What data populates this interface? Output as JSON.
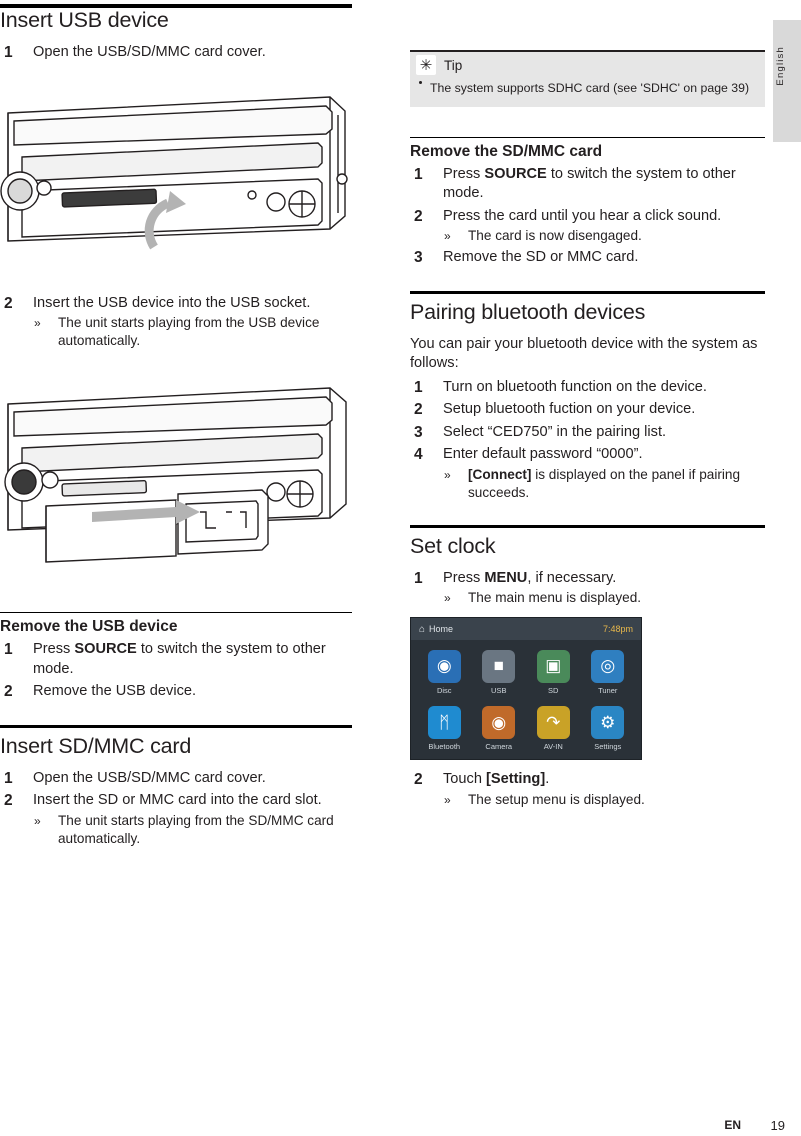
{
  "side_tab": {
    "label": "English"
  },
  "footer": {
    "lang": "EN",
    "page": "19"
  },
  "left": {
    "h_insert_usb": "Insert USB device",
    "step1": "Open the USB/SD/MMC card cover.",
    "step2": "Insert the USB device into the USB socket.",
    "step2_note": "The unit starts playing from the USB device automatically.",
    "h_remove_usb": "Remove the USB device",
    "r1_a": "Press ",
    "r1_b": "SOURCE",
    "r1_c": " to switch the system to other mode.",
    "r2": "Remove the USB device.",
    "h_insert_sd": "Insert SD/MMC card",
    "s1": "Open the USB/SD/MMC card cover.",
    "s2": "Insert the SD or MMC card into the card slot.",
    "s2_note": "The unit starts playing from the SD/MMC card automatically.",
    "numbers": {
      "n1": "1",
      "n2": "2",
      "n3": "3",
      "n4": "4"
    },
    "arrow": "»"
  },
  "right": {
    "tip": {
      "icon": "✳",
      "title": "Tip",
      "text": "The system supports SDHC card (see 'SDHC' on page 39)"
    },
    "h_remove_sd": "Remove the SD/MMC card",
    "rs1_a": "Press ",
    "rs1_b": "SOURCE",
    "rs1_c": " to switch the system to other mode.",
    "rs2": "Press the card until you hear a click sound.",
    "rs2_note": "The card is now disengaged.",
    "rs3": "Remove the SD or MMC card.",
    "h_pairing": "Pairing bluetooth devices",
    "pair_intro": "You can pair your bluetooth device with the system as follows:",
    "p1": "Turn on bluetooth function on the device.",
    "p2": "Setup bluetooth fuction on your device.",
    "p3": "Select “CED750” in the pairing list.",
    "p4": "Enter default password “0000”.",
    "p4_note_a": "[Connect]",
    "p4_note_b": " is displayed on the panel if pairing succeeds.",
    "h_set_clock": "Set clock",
    "c1_a": "Press ",
    "c1_b": "MENU",
    "c1_c": ", if necessary.",
    "c1_note": "The main menu is displayed.",
    "c2_a": "Touch ",
    "c2_b": "[Setting]",
    "c2_c": ".",
    "c2_note": "The setup menu is displayed.",
    "numbers": {
      "n1": "1",
      "n2": "2",
      "n3": "3",
      "n4": "4"
    },
    "arrow": "»"
  },
  "lcd": {
    "home_label": "Home",
    "home_icon": "⌂",
    "time": "7:48pm",
    "items": [
      {
        "label": "Disc",
        "icon": "●",
        "color": "#2a6fb5",
        "icon_name": "disc-icon"
      },
      {
        "label": "USB",
        "icon": "⬛",
        "color": "#5a6b78",
        "icon_name": "usb-icon"
      },
      {
        "label": "SD",
        "icon": "■",
        "color": "#4a8a5a",
        "icon_name": "sd-card-icon"
      },
      {
        "label": "Tuner",
        "icon": "◉",
        "color": "#2f7fc0",
        "icon_name": "tuner-icon"
      },
      {
        "label": "Bluetooth",
        "icon": "ᛗ",
        "color": "#1f8bd0",
        "icon_name": "bluetooth-icon"
      },
      {
        "label": "Camera",
        "icon": "●",
        "color": "#c06a2a",
        "icon_name": "camera-icon"
      },
      {
        "label": "AV-IN",
        "icon": "⤳",
        "color": "#c9a227",
        "icon_name": "av-in-icon"
      },
      {
        "label": "Settings",
        "icon": "⚙",
        "color": "#2a86c4",
        "icon_name": "settings-icon"
      }
    ]
  }
}
